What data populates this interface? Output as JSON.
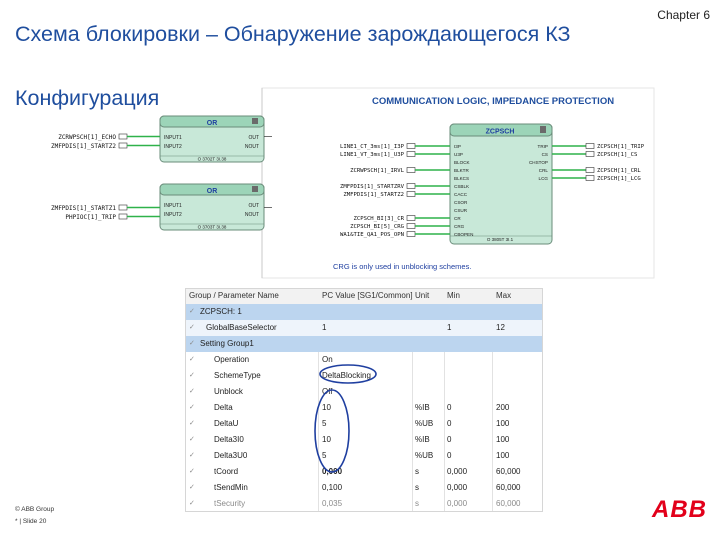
{
  "header": {
    "chapter": "Chapter 6",
    "title": "Схема блокировки – Обнаружение зарождающегося КЗ",
    "subtitle": "Конфигурация"
  },
  "diagram": {
    "title": "COMMUNICATION LOGIC, IMPEDANCE PROTECTION",
    "note": "CRG is only used in unblocking schemes.",
    "or_block_1": {
      "name": "OR",
      "inputs": [
        "INPUT1",
        "INPUT2"
      ],
      "outputs": [
        "OUT",
        "NOUT"
      ],
      "id": "O 3702T 3I.38",
      "signals_in": [
        "ZCRWPSCH[1]_ECHO",
        "ZMFPDIS[1]_STARTZ2"
      ]
    },
    "or_block_2": {
      "name": "OR",
      "inputs": [
        "INPUT1",
        "INPUT2"
      ],
      "outputs": [
        "OUT",
        "NOUT"
      ],
      "id": "O 3703T 3I.38",
      "signals_in": [
        "ZMFPDIS[1]_STARTZ1",
        "PHPIOC[1]_TRIP"
      ]
    },
    "zcpsch": {
      "name": "ZCPSCH",
      "inputs": [
        "I3P",
        "U3P",
        "BLOCK",
        "BLKTR",
        "BLKCS",
        "CSBLK",
        "CACC",
        "CSOR",
        "CSUR",
        "CR",
        "CRG",
        "CBOPEN"
      ],
      "outputs": [
        "TRIP",
        "CS",
        "CHSTOP",
        "CRL",
        "LCG"
      ],
      "id": "O 3805T 3I.1",
      "signals_in": [
        "LINE1_CT_3ms[1]_I3P",
        "LINE1_VT_3ms[1]_U3P",
        "ZCRWPSCH[1]_IRVL",
        "ZMFPDIS[1]_STARTZRV",
        "ZMFPDIS[1]_STARTZ2",
        "ZCPSCH_BI[3]_CR",
        "ZCPSCH_BI[5]_CRG",
        "WA1&TIE_QA1_POS_OPN"
      ],
      "signals_out": [
        "ZCPSCH[1]_TRIP",
        "ZCPSCH[1]_CS",
        "ZCPSCH[1]_CRL",
        "ZCPSCH[1]_LCG"
      ]
    }
  },
  "param_table": {
    "columns": [
      "Group / Parameter Name",
      "PC Value [SG1/Common]",
      "Unit",
      "Min",
      "Max"
    ],
    "rows": [
      {
        "name": "ZCPSCH: 1",
        "value": "",
        "unit": "",
        "min": "",
        "max": ""
      },
      {
        "name": "GlobalBaseSelector",
        "value": "1",
        "unit": "",
        "min": "1",
        "max": "12"
      },
      {
        "name": "Setting Group1",
        "value": "",
        "unit": "",
        "min": "",
        "max": ""
      },
      {
        "name": "Operation",
        "value": "On",
        "unit": "",
        "min": "",
        "max": ""
      },
      {
        "name": "SchemeType",
        "value": "DeltaBlocking",
        "unit": "",
        "min": "",
        "max": ""
      },
      {
        "name": "Unblock",
        "value": "Off",
        "unit": "",
        "min": "",
        "max": ""
      },
      {
        "name": "Delta",
        "value": "10",
        "unit": "%IB",
        "min": "0",
        "max": "200"
      },
      {
        "name": "DeltaU",
        "value": "5",
        "unit": "%UB",
        "min": "0",
        "max": "100"
      },
      {
        "name": "Delta3I0",
        "value": "10",
        "unit": "%IB",
        "min": "0",
        "max": "100"
      },
      {
        "name": "Delta3U0",
        "value": "5",
        "unit": "%UB",
        "min": "0",
        "max": "100"
      },
      {
        "name": "tCoord",
        "value": "0,000",
        "unit": "s",
        "min": "0,000",
        "max": "60,000"
      },
      {
        "name": "tSendMin",
        "value": "0,100",
        "unit": "s",
        "min": "0,000",
        "max": "60,000"
      },
      {
        "name": "tSecurity",
        "value": "0,035",
        "unit": "s",
        "min": "0,000",
        "max": "60,000"
      }
    ]
  },
  "footer": {
    "copyright": "© ABB Group",
    "slide": "* | Slide 20",
    "logo": "ABB"
  },
  "colors": {
    "title": "#1f4e9e",
    "block_fill": "#c8e8d8",
    "block_header": "#9cd4b8",
    "signal_green": "#2fb24a",
    "highlight_circle": "#1f3fa0",
    "abb_red": "#e2001a"
  }
}
